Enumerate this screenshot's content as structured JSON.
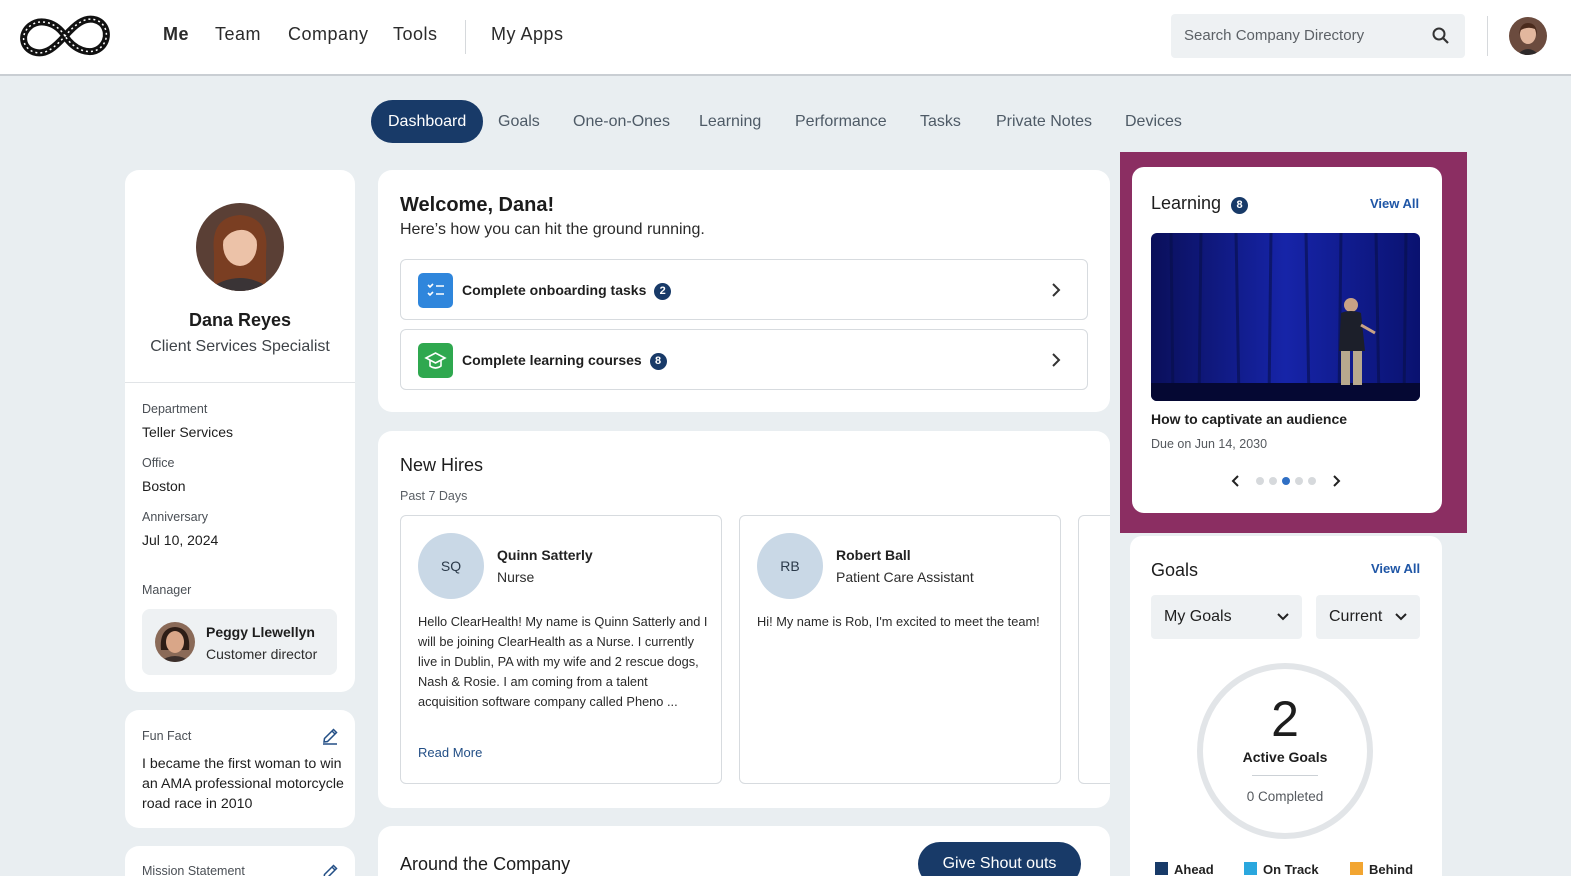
{
  "nav": {
    "items": [
      "Me",
      "Team",
      "Company",
      "Tools",
      "My Apps"
    ]
  },
  "search": {
    "placeholder": "Search Company Directory"
  },
  "tabs": [
    "Dashboard",
    "Goals",
    "One-on-Ones",
    "Learning",
    "Performance",
    "Tasks",
    "Private Notes",
    "Devices"
  ],
  "profile": {
    "name": "Dana Reyes",
    "title": "Client Services Specialist",
    "department_label": "Department",
    "department": "Teller Services",
    "office_label": "Office",
    "office": "Boston",
    "anniversary_label": "Anniversary",
    "anniversary": "Jul 10, 2024",
    "manager_label": "Manager",
    "manager": {
      "name": "Peggy Llewellyn",
      "role": "Customer director"
    }
  },
  "fun_fact": {
    "label": "Fun Fact",
    "text": "I became the first woman to win an AMA professional motorcycle road race in 2010"
  },
  "mission": {
    "label": "Mission Statement"
  },
  "welcome": {
    "title": "Welcome, Dana!",
    "subtitle": "Here’s how you can hit the ground running.",
    "tasks": [
      {
        "label": "Complete onboarding tasks",
        "count": "2"
      },
      {
        "label": "Complete learning courses",
        "count": "8"
      }
    ]
  },
  "new_hires": {
    "title": "New Hires",
    "period": "Past 7 Days",
    "items": [
      {
        "initials": "SQ",
        "name": "Quinn Satterly",
        "role": "Nurse",
        "bio": "Hello ClearHealth! My name is Quinn Satterly and I will be joining ClearHealth as a Nurse. I currently live in Dublin, PA with my wife and 2 rescue dogs, Nash & Rosie. I am coming from a talent acquisition software company called Pheno ...",
        "read_more": "Read More"
      },
      {
        "initials": "RB",
        "name": "Robert Ball",
        "role": "Patient Care Assistant",
        "bio": "Hi! My name is Rob, I'm excited to meet the team!",
        "read_more": ""
      }
    ]
  },
  "around": {
    "title": "Around the Company",
    "button": "Give Shout outs"
  },
  "learning": {
    "title": "Learning",
    "count": "8",
    "view_all": "View All",
    "course_title": "How to captivate an audience",
    "due": "Due on Jun 14, 2030",
    "carousel": {
      "total": 5,
      "active": 3
    }
  },
  "goals": {
    "title": "Goals",
    "view_all": "View All",
    "filter1": "My Goals",
    "filter2": "Current",
    "active_count": "2",
    "active_label": "Active Goals",
    "completed": "0 Completed",
    "legend": [
      "Ahead",
      "On Track",
      "Behind"
    ]
  },
  "colors": {
    "primary": "#183a68",
    "highlight": "#8b2e62",
    "ahead": "#183a68",
    "on_track": "#2aa7de",
    "behind": "#f2a531"
  }
}
